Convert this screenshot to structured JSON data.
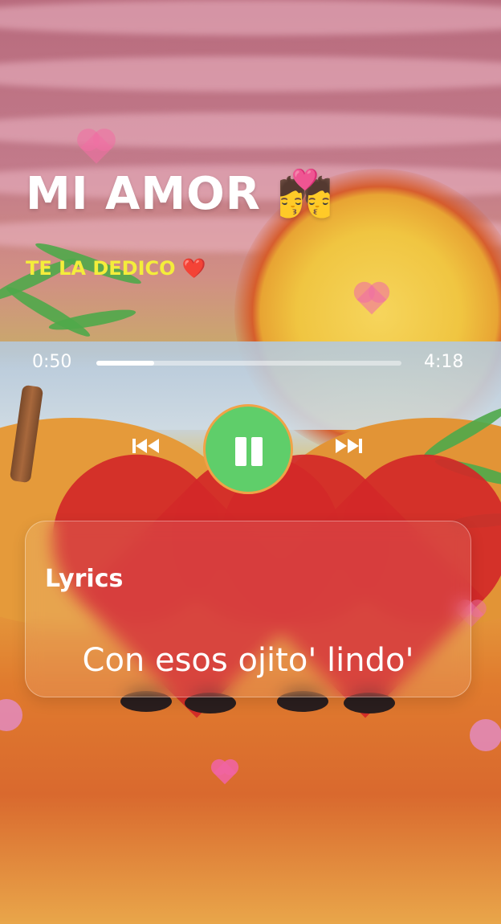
{
  "song": {
    "title": "MI AMOR 💏",
    "dedication": "TE LA DEDICO ❤️"
  },
  "player": {
    "elapsed": "0:50",
    "duration": "4:18",
    "progress_fraction": 0.19,
    "state": "playing",
    "controls": {
      "previous_icon": "skip-previous-icon",
      "pause_icon": "pause-icon",
      "next_icon": "skip-next-icon"
    }
  },
  "lyrics": {
    "title": "Lyrics",
    "current_line": "Con esos ojito' lindo'"
  },
  "colors": {
    "title": "#ffffff",
    "dedication": "#f4ed3b",
    "play_button": "#5fce6a",
    "play_button_border": "#f0a347",
    "floating_hearts": "#f06fa3"
  }
}
